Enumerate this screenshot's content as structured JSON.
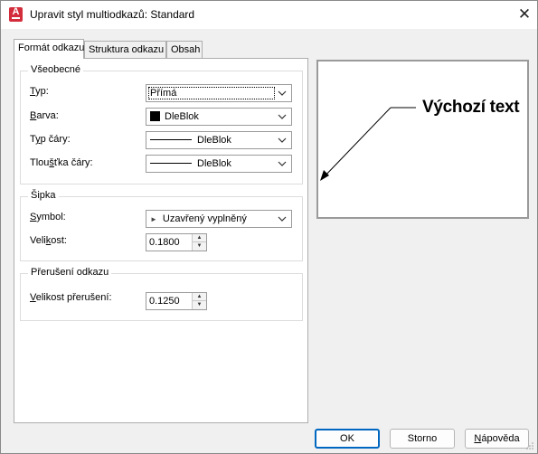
{
  "window": {
    "title": "Upravit styl multiodkazů: Standard",
    "app_icon_letter": "A"
  },
  "tabs": [
    {
      "label": "Formát odkazu",
      "active": true
    },
    {
      "label": "Struktura odkazu",
      "active": false
    },
    {
      "label": "Obsah",
      "active": false
    }
  ],
  "general": {
    "title": "Všeobecné",
    "type_label_u": "T",
    "type_label_rest": "yp:",
    "type_value": "Přímá",
    "color_label_u": "B",
    "color_label_rest": "arva:",
    "color_value": "DleBlok",
    "color_swatch": "#000000",
    "linetype_label_u": "y",
    "linetype_label_pre": "T",
    "linetype_label_rest": "p čáry:",
    "linetype_value": "DleBlok",
    "lineweight_label_pre": "Tlou",
    "lineweight_label_u": "š",
    "lineweight_label_rest": "ťka čáry:",
    "lineweight_value": "DleBlok"
  },
  "arrow": {
    "title": "Šipka",
    "symbol_label_u": "S",
    "symbol_label_rest": "ymbol:",
    "symbol_value": "Uzavřený vyplněný",
    "size_label_pre": "Veli",
    "size_label_u": "k",
    "size_label_rest": "ost:",
    "size_value": "0.1800"
  },
  "break": {
    "title": "Přerušení odkazu",
    "size_label_u": "V",
    "size_label_rest": "elikost přerušení:",
    "size_value": "0.1250"
  },
  "preview": {
    "text": "Výchozí text"
  },
  "buttons": {
    "ok": "OK",
    "cancel": "Storno",
    "help_u": "N",
    "help_rest": "ápověda"
  }
}
